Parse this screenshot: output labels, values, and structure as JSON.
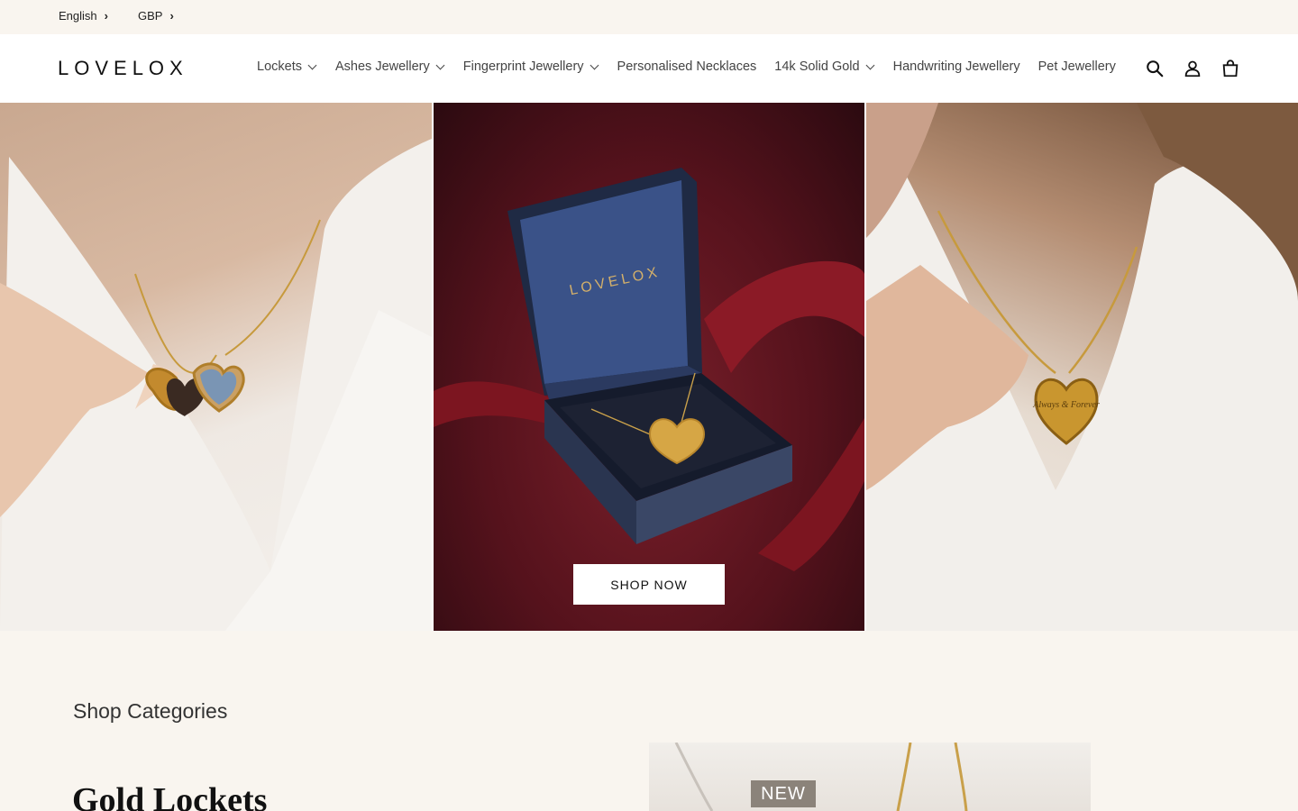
{
  "topbar": {
    "language": "English",
    "currency": "GBP"
  },
  "header": {
    "logo": "LOVELOX",
    "nav": [
      {
        "label": "Lockets",
        "dropdown": true
      },
      {
        "label": "Ashes Jewellery",
        "dropdown": true
      },
      {
        "label": "Fingerprint Jewellery",
        "dropdown": true
      },
      {
        "label": "Personalised Necklaces",
        "dropdown": false
      },
      {
        "label": "14k Solid Gold",
        "dropdown": true
      },
      {
        "label": "Handwriting Jewellery",
        "dropdown": false
      },
      {
        "label": "Pet Jewellery",
        "dropdown": false
      }
    ],
    "icons": [
      "search-icon",
      "account-icon",
      "cart-icon"
    ]
  },
  "hero": {
    "box_logo": "LOVELOX",
    "engraving": "Always & Forever",
    "cta": "SHOP NOW"
  },
  "categories": {
    "heading": "Shop Categories",
    "first_title": "Gold Lockets",
    "badge": "NEW"
  },
  "colors": {
    "page_bg": "#f9f5ef",
    "header_bg": "#ffffff",
    "hero_mid": "#55121c",
    "box_blue": "#2d3e6b",
    "gold": "#c9a04a"
  }
}
